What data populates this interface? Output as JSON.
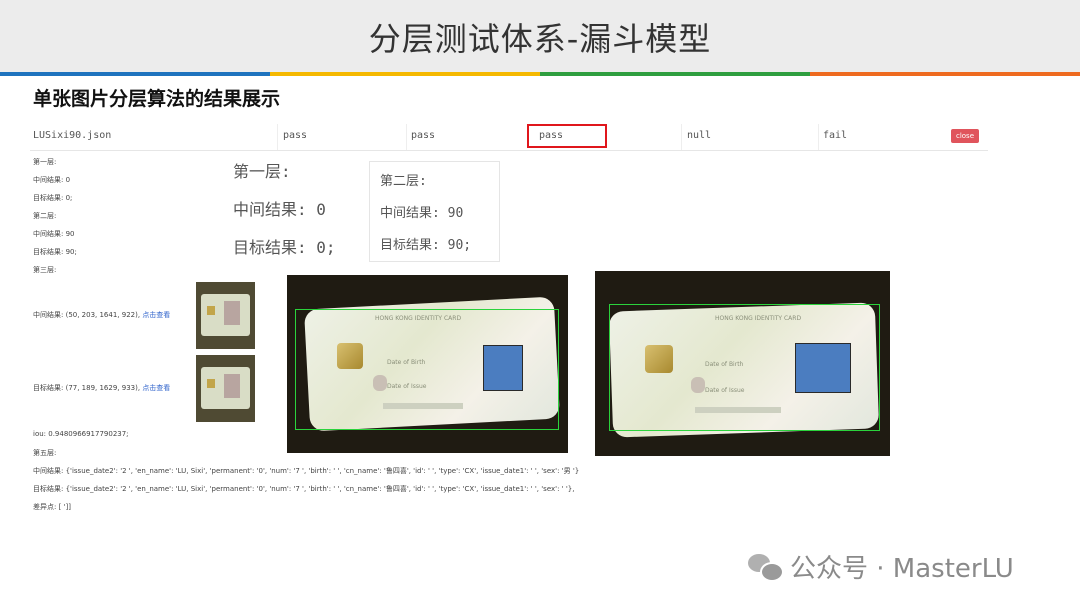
{
  "header": {
    "title": "分层测试体系-漏斗模型"
  },
  "colors": {
    "bar": [
      "#1e73be",
      "#f5b800",
      "#2e9e3f",
      "#ee6a1f"
    ],
    "highlight": "#e0161c",
    "close": "#e0545c",
    "bbox": "#2bd33c",
    "mask": "#4b7dc0"
  },
  "subtitle": "单张图片分层算法的结果展示",
  "result_row": {
    "file": "LUSixi90.json",
    "statuses": [
      "pass",
      "pass",
      "pass",
      "null",
      "fail"
    ],
    "close_label": "close"
  },
  "log": {
    "layer1": "第一层:",
    "layer1_mid": "中间结果: 0",
    "layer1_target": "目标结果: 0;",
    "layer2": "第二层:",
    "layer2_mid": "中间结果: 90",
    "layer2_target": "目标结果: 90;",
    "layer3": "第三层:",
    "layer3_mid": "中间结果: (50, 203, 1641, 922),",
    "layer3_target": "目标结果: (77, 189, 1629, 933),",
    "view_link": "点击查看",
    "iou": "iou: 0.9480966917790237;",
    "layer5": "第五层:",
    "layer5_mid": "中间结果: {'issue_date2': '2               ', 'en_name': 'LU, Sixi', 'permanent': '0', 'num': '7                ', 'birth': '                 ', 'cn_name': '鲁四喜', 'id': '                 ', 'type': 'CX', 'issue_date1': '            ', 'sex': '男  '}",
    "layer5_target": "目标结果: {'issue_date2': '2               ', 'en_name': 'LU, Sixi', 'permanent': '0', 'num': '7                ', 'birth': '                 ', 'cn_name': '鲁四喜', 'id': '                 ', 'type': 'CX', 'issue_date1': '            ', 'sex': '     '},",
    "diff": "差异点: [                              ']]"
  },
  "zoom_layer1": {
    "title": "第一层:",
    "mid": "中间结果: 0",
    "target": "目标结果: 0;"
  },
  "zoom_layer2": {
    "title": "第二层:",
    "mid": "中间结果: 90",
    "target": "目标结果: 90;"
  },
  "card_text": {
    "title": "HONG KONG IDENTITY CARD",
    "birth": "Date of Birth",
    "issue": "Date of Issue"
  },
  "footer": {
    "text": "公众号 · MasterLU"
  }
}
